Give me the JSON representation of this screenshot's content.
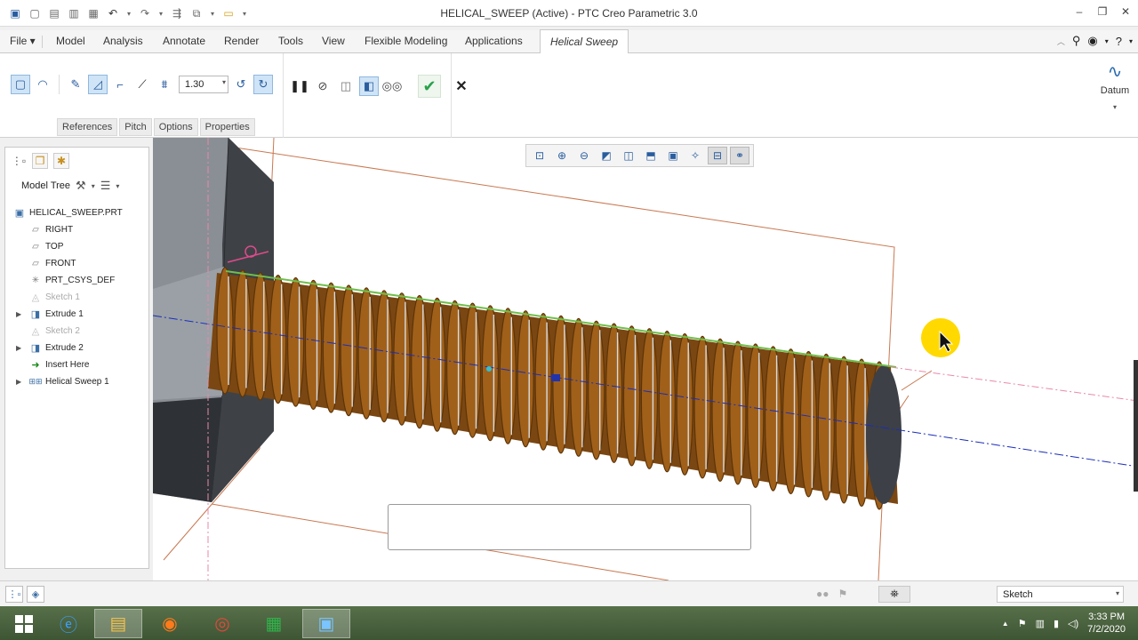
{
  "window": {
    "title": "HELICAL_SWEEP (Active) - PTC Creo Parametric 3.0",
    "controls": [
      "minimize-icon",
      "restore-icon",
      "close-icon"
    ]
  },
  "quick_access": [
    "app-icon",
    "new-icon",
    "open-icon",
    "open-recent-icon",
    "save-icon",
    "undo-icon",
    "redo-icon",
    "regenerate-icon",
    "windows-icon",
    "close-window-icon",
    "customize-icon"
  ],
  "ribbon_tabs": [
    {
      "label": "File ▾"
    },
    {
      "label": "Model"
    },
    {
      "label": "Analysis"
    },
    {
      "label": "Annotate"
    },
    {
      "label": "Render"
    },
    {
      "label": "Tools"
    },
    {
      "label": "View"
    },
    {
      "label": "Flexible Modeling"
    },
    {
      "label": "Applications"
    },
    {
      "label": "Helical Sweep"
    }
  ],
  "ribbon": {
    "pitch_value": "1.30",
    "slide_tabs": [
      "References",
      "Pitch",
      "Options",
      "Properties"
    ],
    "datum_label": "Datum"
  },
  "model_tree": {
    "title": "Model Tree",
    "items": [
      {
        "label": "HELICAL_SWEEP.PRT",
        "icon": "part-icon",
        "dim": false
      },
      {
        "label": "RIGHT",
        "icon": "datum-plane-icon",
        "dim": false
      },
      {
        "label": "TOP",
        "icon": "datum-plane-icon",
        "dim": false
      },
      {
        "label": "FRONT",
        "icon": "datum-plane-icon",
        "dim": false
      },
      {
        "label": "PRT_CSYS_DEF",
        "icon": "csys-icon",
        "dim": false
      },
      {
        "label": "Sketch 1",
        "icon": "sketch-icon",
        "dim": true
      },
      {
        "label": "Extrude 1",
        "icon": "extrude-icon",
        "dim": false
      },
      {
        "label": "Sketch 2",
        "icon": "sketch-icon",
        "dim": true
      },
      {
        "label": "Extrude 2",
        "icon": "extrude-icon",
        "dim": false
      },
      {
        "label": "Insert Here",
        "icon": "insert-arrow-icon",
        "dim": false
      },
      {
        "label": "Helical Sweep 1",
        "icon": "helical-sweep-icon",
        "dim": false
      }
    ]
  },
  "status": {
    "filter_value": "Sketch"
  },
  "taskbar": {
    "time": "3:33 PM",
    "date": "7/2/2020"
  },
  "colors": {
    "thread": "#a0601a",
    "thread_dark": "#5c3408",
    "head": "#6b6f74",
    "datum_line": "#c87850",
    "axis": "#1a2eb8",
    "cursor_highlight": "#ffd900"
  }
}
